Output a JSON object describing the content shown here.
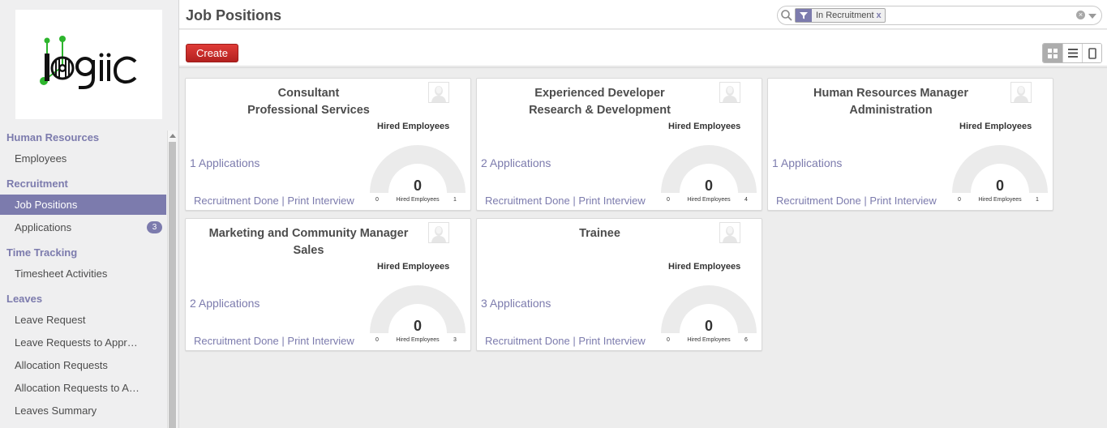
{
  "app": {
    "title": "Job Positions",
    "accent": "#7c7bad"
  },
  "sidebar": {
    "sections": [
      {
        "title": "Human Resources",
        "items": [
          {
            "label": "Employees"
          }
        ]
      },
      {
        "title": "Recruitment",
        "items": [
          {
            "label": "Job Positions",
            "active": true
          },
          {
            "label": "Applications",
            "badge": "3"
          }
        ]
      },
      {
        "title": "Time Tracking",
        "items": [
          {
            "label": "Timesheet Activities"
          }
        ]
      },
      {
        "title": "Leaves",
        "items": [
          {
            "label": "Leave Request"
          },
          {
            "label": "Leave Requests to Appr…"
          },
          {
            "label": "Allocation Requests"
          },
          {
            "label": "Allocation Requests to A…"
          },
          {
            "label": "Leaves Summary"
          }
        ]
      }
    ]
  },
  "search": {
    "facet_label": "In Recruitment",
    "facet_remove": "x",
    "facet_icon": "filter-icon"
  },
  "toolbar": {
    "create_label": "Create",
    "views": [
      "kanban-view-icon",
      "list-view-icon",
      "form-view-icon"
    ]
  },
  "cards": [
    {
      "name_line1": "Consultant",
      "name_line2": "Professional Services",
      "hired_label": "Hired Employees",
      "applications": "1 Applications",
      "action_done": "Recruitment Done",
      "action_sep": "|",
      "action_print": "Print Interview",
      "gauge_value": "0",
      "gauge_min": "0",
      "gauge_max": "1",
      "gauge_title": "Hired Employees"
    },
    {
      "name_line1": "Experienced Developer",
      "name_line2": "Research & Development",
      "hired_label": "Hired Employees",
      "applications": "2 Applications",
      "action_done": "Recruitment Done",
      "action_sep": "|",
      "action_print": "Print Interview",
      "gauge_value": "0",
      "gauge_min": "0",
      "gauge_max": "4",
      "gauge_title": "Hired Employees"
    },
    {
      "name_line1": "Human Resources Manager",
      "name_line2": "Administration",
      "hired_label": "Hired Employees",
      "applications": "1 Applications",
      "action_done": "Recruitment Done",
      "action_sep": "|",
      "action_print": "Print Interview",
      "gauge_value": "0",
      "gauge_min": "0",
      "gauge_max": "1",
      "gauge_title": "Hired Employees"
    },
    {
      "name_line1": "Marketing and Community Manager",
      "name_line2": "Sales",
      "hired_label": "Hired Employees",
      "applications": "2 Applications",
      "action_done": "Recruitment Done",
      "action_sep": "|",
      "action_print": "Print Interview",
      "gauge_value": "0",
      "gauge_min": "0",
      "gauge_max": "3",
      "gauge_title": "Hired Employees"
    },
    {
      "name_line1": "Trainee",
      "name_line2": "",
      "hired_label": "Hired Employees",
      "applications": "3 Applications",
      "action_done": "Recruitment Done",
      "action_sep": "|",
      "action_print": "Print Interview",
      "gauge_value": "0",
      "gauge_min": "0",
      "gauge_max": "6",
      "gauge_title": "Hired Employees"
    }
  ]
}
